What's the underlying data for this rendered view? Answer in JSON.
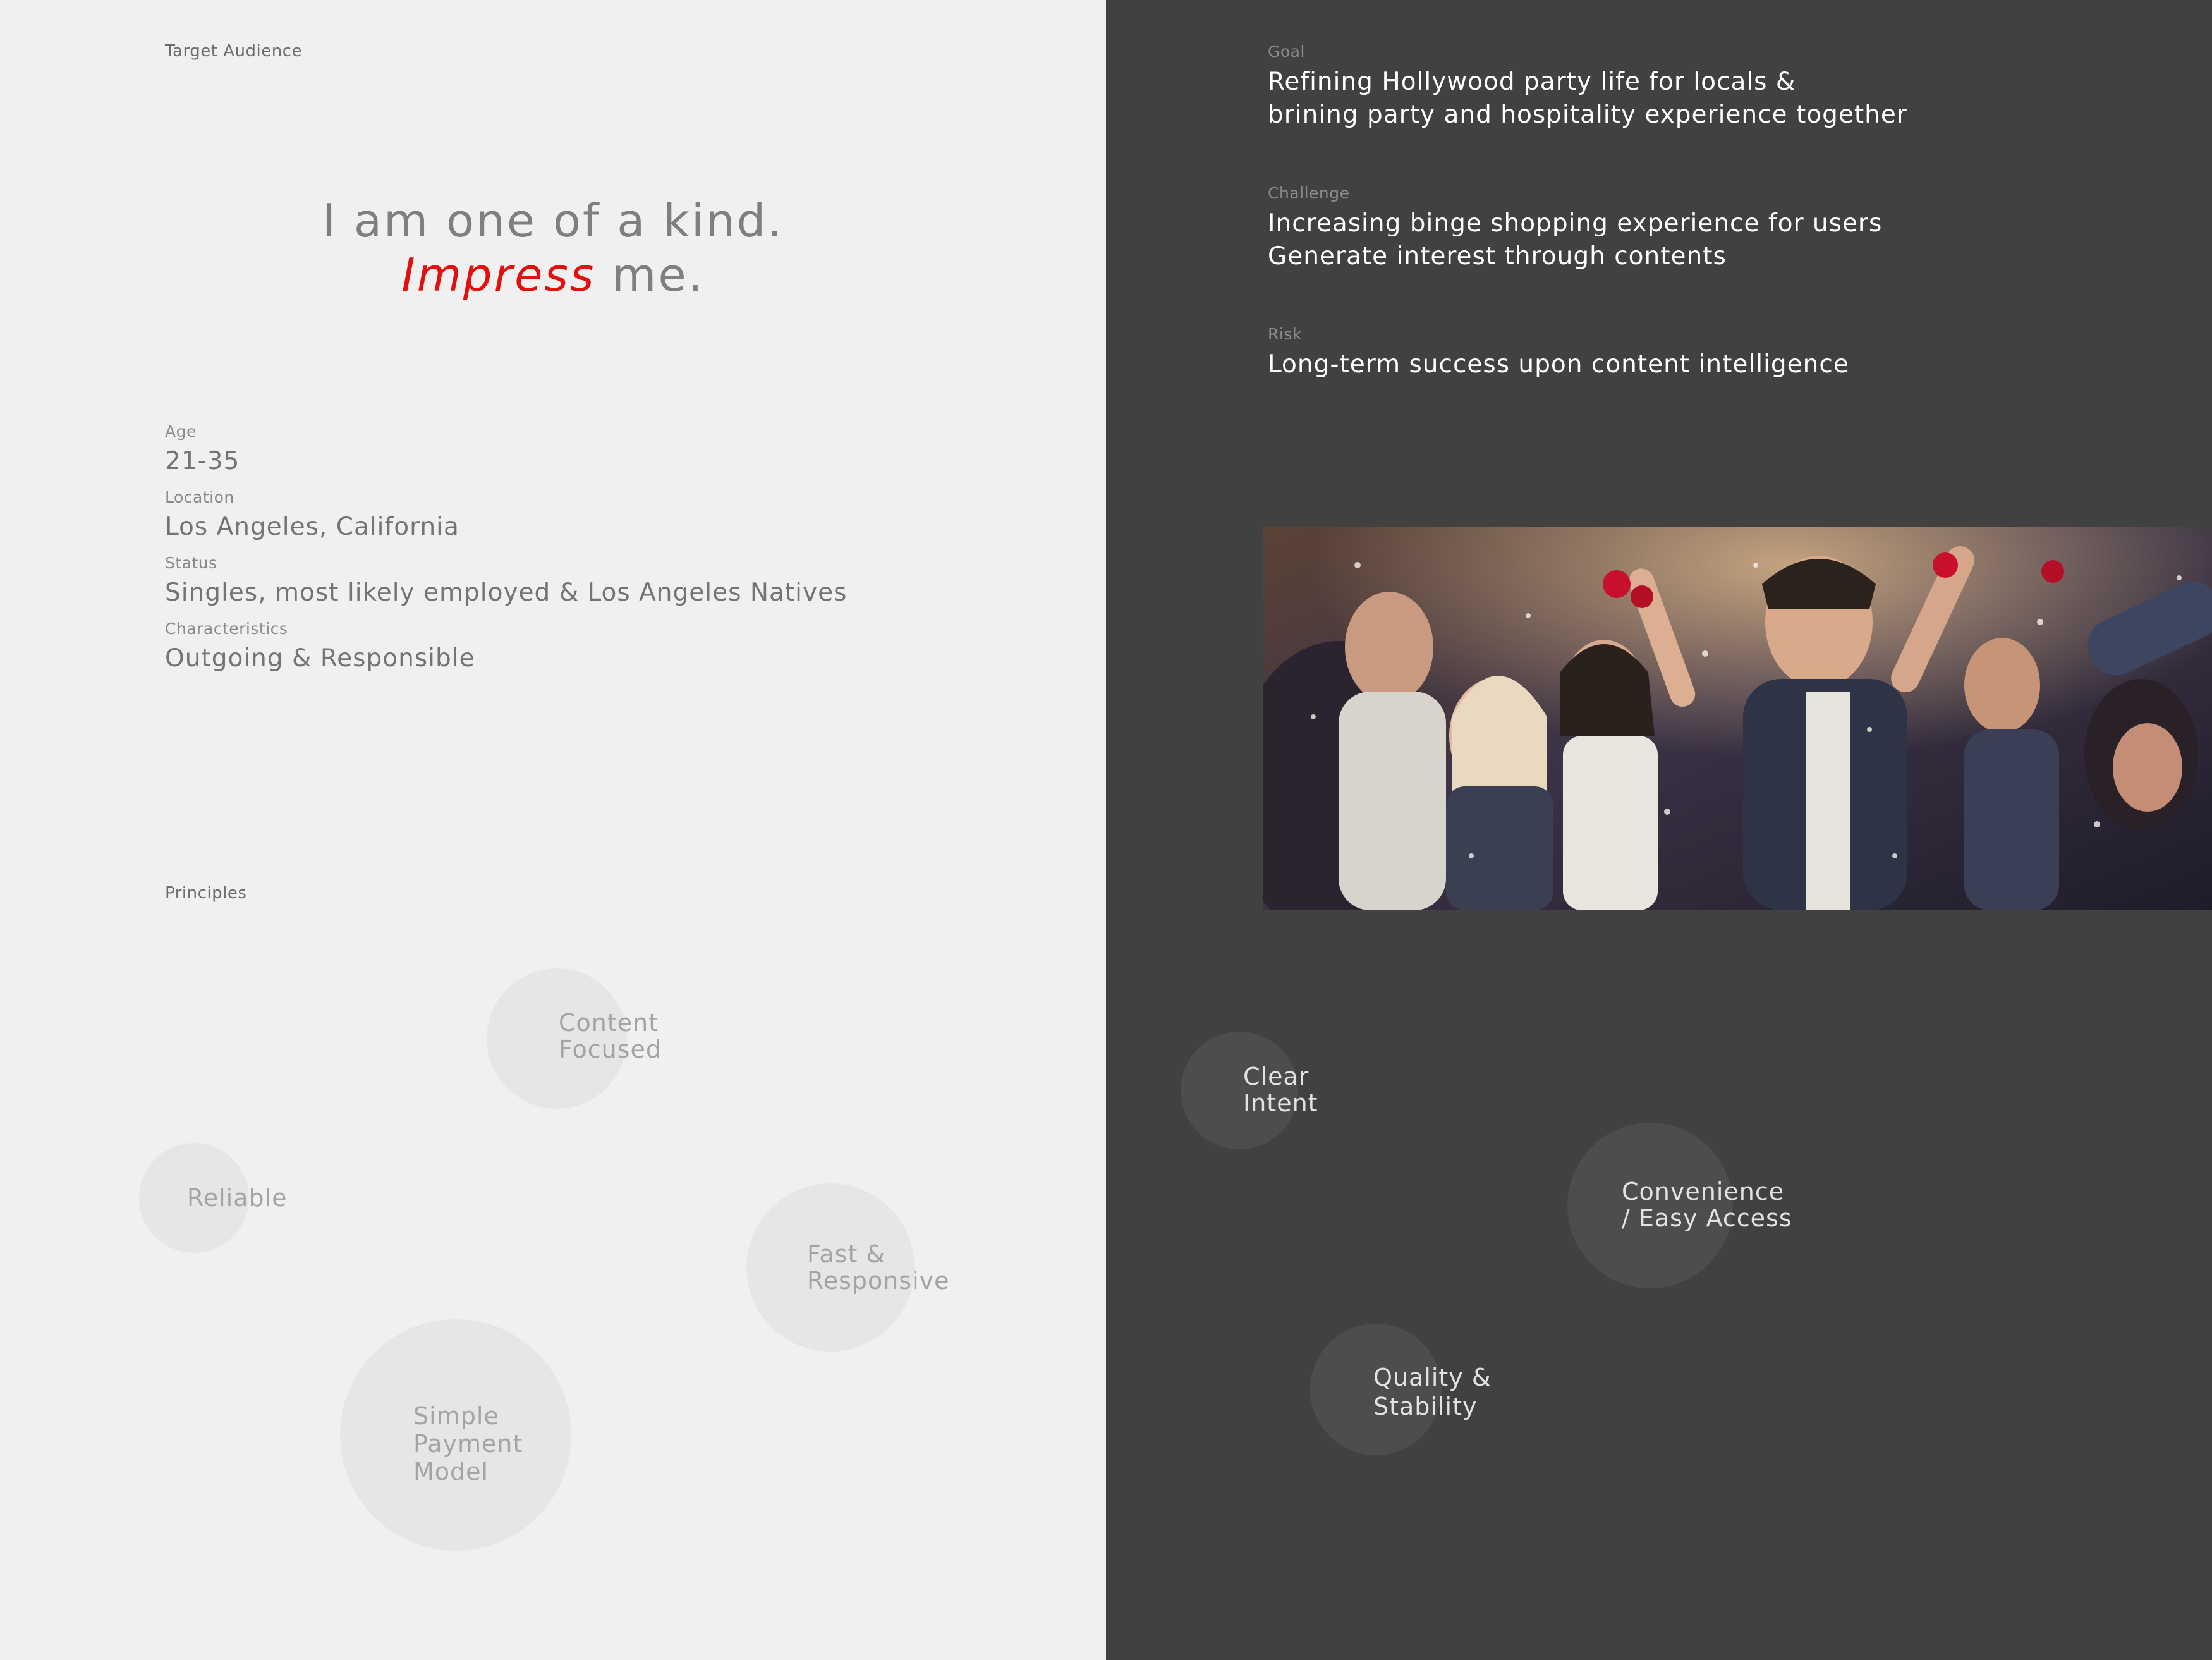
{
  "audience": {
    "section_label": "Target Audience",
    "headline_line1": "I am one of a kind.",
    "headline_accent": "Impress",
    "headline_rest": " me.",
    "accent_color": "#e31010",
    "fields": [
      {
        "label": "Age",
        "value": "21-35"
      },
      {
        "label": "Location",
        "value": "Los Angeles, California"
      },
      {
        "label": "Status",
        "value": "Singles, most likely employed & Los Angeles Natives"
      },
      {
        "label": "Characteristics",
        "value": "Outgoing & Responsible"
      }
    ]
  },
  "principles": {
    "section_label": "Principles",
    "left_items": [
      "Content\nFocused",
      "Reliable",
      "Fast &\nResponsive",
      "Simple\nPayment\nModel"
    ],
    "right_items": [
      "Clear\nIntent",
      "Convenience\n/ Easy Access",
      "Quality &\nStability"
    ]
  },
  "overview": {
    "goal_label": "Goal",
    "goal_line1": "Refining Hollywood party life for locals &",
    "goal_line2": "brining party and hospitality experience together",
    "challenge_label": "Challenge",
    "challenge_line1": "Increasing binge shopping experience for users",
    "challenge_line2": "Generate interest through contents",
    "risk_label": "Risk",
    "risk_line1": "Long-term success upon content intelligence"
  },
  "colors": {
    "left_bg": "#f0f0f0",
    "right_bg": "#414141"
  }
}
